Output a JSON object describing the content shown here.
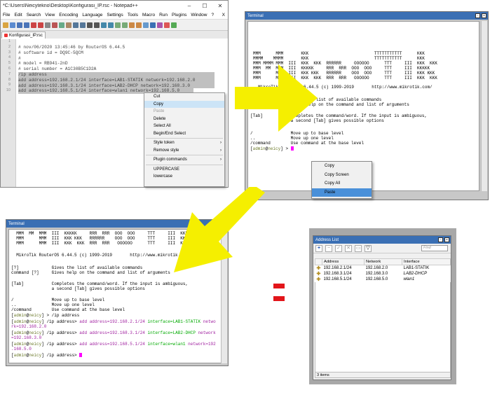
{
  "notepad": {
    "title": "*C:\\Users\\Neicytekno\\Desktop\\Konfigurasi_IP.rsc - Notepad++",
    "win_min": "–",
    "win_max": "☐",
    "win_close": "✕",
    "menus": [
      "File",
      "Edit",
      "Search",
      "View",
      "Encoding",
      "Language",
      "Settings",
      "Tools",
      "Macro",
      "Run",
      "Plugins",
      "Window",
      "?"
    ],
    "menu_close": "X",
    "tab_label": "Konfigurasi_IP.rsc",
    "line_numbers": [
      "1",
      "2",
      "3",
      "4",
      "5",
      "6",
      "7",
      "8",
      "9",
      "10"
    ],
    "lines": [
      "# nov/06/2020 13:45:46 by RouterOS 6.44.5",
      "# software id = DQ9C-5QCM",
      "#",
      "# model = RB941-2nD",
      "# serial number = A1C30B5C1D2A",
      "/ip address",
      "add address=192.168.2.1/24 interface=LAB1-STATIK network=192.168.2.0",
      "add address=192.168.3.1/24 interface=LAB2-DHCP network=192.168.3.0",
      "add address=192.168.5.1/24 interface=wlan1 network=192.168.5.0",
      ""
    ],
    "context_menu": [
      {
        "label": "Cut",
        "state": "normal"
      },
      {
        "label": "Copy",
        "state": "highlight"
      },
      {
        "label": "Paste",
        "state": "disabled"
      },
      {
        "label": "Delete",
        "state": "normal"
      },
      {
        "label": "Select All",
        "state": "normal"
      },
      {
        "label": "Begin/End Select",
        "state": "normal"
      },
      {
        "label": "Style token",
        "state": "submenu"
      },
      {
        "label": "Remove style",
        "state": "submenu"
      },
      {
        "label": "Plugin commands",
        "state": "submenu"
      },
      {
        "label": "UPPERCASE",
        "state": "normal"
      },
      {
        "label": "lowercase",
        "state": "normal"
      }
    ]
  },
  "terminal1": {
    "title": "Terminal",
    "logo_lines": [
      "MMM      MMM       KKK                          TTTTTTTTTTT      KKK",
      "MMMM    MMMM       KKK                          TTTTTTTTTTT      KKK",
      "MMM MMMM MMM  III  KKK  KKK  RRRRRR     OOOOOO      TTT     III  KKK  KKK",
      "MMM  MM  MMM  III  KKKKK     RRR  RRR  OOO  OOO     TTT     III  KKKKK",
      "MMM      MMM  III  KKK KKK   RRRRRR    OOO  OOO     TTT     III  KKK KKK",
      "MMM      MMM  III  KKK  KKK  RRR  RRR   OOOOOO      TTT     III  KKK  KKK"
    ],
    "version_line": "  MikroTik RouterOS 6.44.5 (c) 1999-2019       http://www.mikrotik.com/",
    "help_lines": [
      "[?]             Gives the list of available commands",
      "command [?]     Gives help on the command and list of arguments",
      "",
      "[Tab]           Completes the command/word. If the input is ambiguous,",
      "                a second [Tab] gives possible options",
      "",
      "/               Move up to base level",
      "..              Move up one level",
      "/command        Use command at the base level"
    ],
    "prompt_user": "admin",
    "prompt_host": "neicy",
    "prompt_tail": "] > ",
    "context_menu": [
      {
        "label": "Copy",
        "state": "normal"
      },
      {
        "label": "Copy Screen",
        "state": "normal"
      },
      {
        "label": "Copy All",
        "state": "normal"
      },
      {
        "label": "Paste",
        "state": "highlight"
      }
    ]
  },
  "terminal2": {
    "title": "Terminal",
    "logo_lines": [
      "  MMM  MM  MMM  III  KKKKK     RRR  RRR  OOO  OOO     TTT     III  KKKKK",
      "  MMM      MMM  III  KKK KKK   RRRRRR    OOO  OOO     TTT     III  KKK KKK",
      "  MMM      MMM  III  KKK  KKK  RRR  RRR   OOOOOO      TTT     III  KKK  KKK"
    ],
    "version_line": "  MikroTik RouterOS 6.44.5 (c) 1999-2019       http://www.mikrotik.com/",
    "help_lines": [
      "[?]             Gives the list of available commands",
      "command [?]     Gives help on the command and list of arguments",
      "",
      "[Tab]           Completes the command/word. If the input is ambiguous,",
      "                a second [Tab] gives possible options",
      "",
      "/               Move up to base level",
      "..              Move up one level",
      "/command        Use command at the base level"
    ],
    "prompt_user": "admin",
    "prompt_host": "neicy",
    "cmd1": "] > /ip address",
    "path": "] /ip address> ",
    "entries": [
      {
        "add": "add",
        "addr": "address=192.168.2.1/24",
        "iface": "interface=LAB1-STATIK",
        "net1": "netwo",
        "net2": "rk=192.168.2.0"
      },
      {
        "add": "add",
        "addr": "address=192.168.3.1/24",
        "iface": "interface=LAB2-DHCP",
        "net1": "network",
        "net2": "=192.168.3.0"
      },
      {
        "add": "add",
        "addr": "address=192.168.5.1/24",
        "iface": "interface=wlan1",
        "net1": "network=192",
        "net2": ".168.5.0"
      }
    ]
  },
  "address_list": {
    "title": "Address List",
    "find_placeholder": "Find",
    "columns": [
      "Address",
      "Network",
      "Interface"
    ],
    "rows": [
      {
        "address": "192.168.2.1/24",
        "network": "192.168.2.0",
        "interface": "LAB1-STATIK"
      },
      {
        "address": "192.168.3.1/24",
        "network": "192.168.3.0",
        "interface": "LAB2-DHCP"
      },
      {
        "address": "192.168.5.1/24",
        "network": "192.168.5.0",
        "interface": "wlan1"
      }
    ],
    "status": "3 items"
  },
  "colors": {
    "arrow": "#f5ef00",
    "equals": "#e2151a",
    "title_bar": "#3a6fb4",
    "menu_highlight": "#4a90d9"
  }
}
